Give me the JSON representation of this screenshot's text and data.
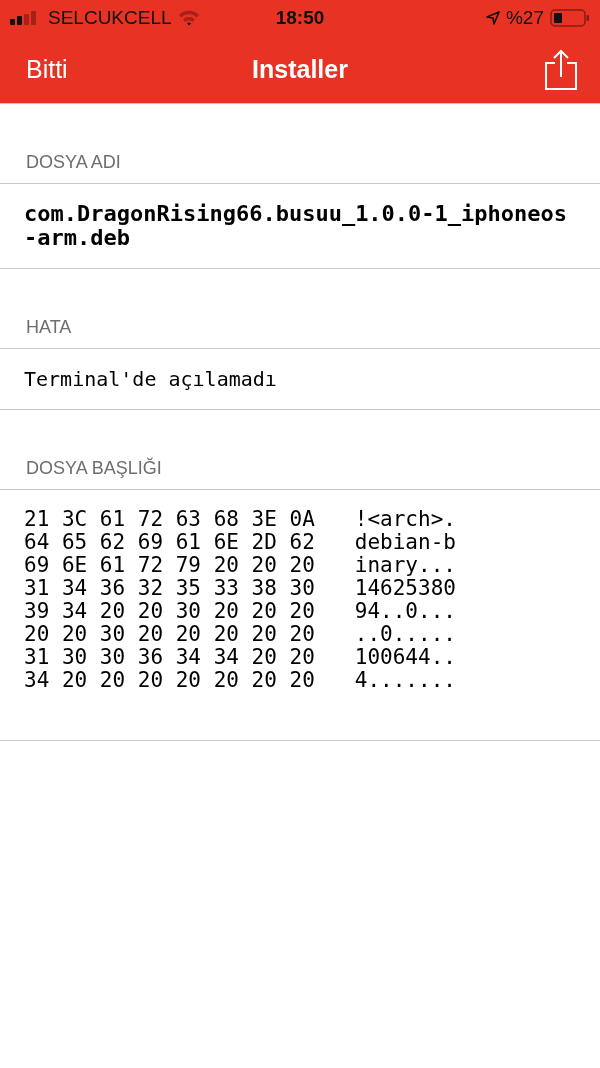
{
  "status_bar": {
    "carrier": "SELCUKCELL",
    "time": "18:50",
    "battery": "%27"
  },
  "nav_bar": {
    "back": "Bitti",
    "title": "Installer"
  },
  "sections": [
    {
      "kind": "text",
      "header": "DOSYA ADI",
      "value": "com.DragonRising66.busuu_1.0.0-1_iphoneos-arm.deb",
      "bold": true
    },
    {
      "kind": "text",
      "header": "HATA",
      "value": "Terminal'de açılamadı",
      "bold": false
    },
    {
      "kind": "hex",
      "header": "DOSYA BAŞLIĞI",
      "rows": [
        {
          "hex": "21 3C 61 72 63 68 3E 0A",
          "ascii": "!<arch>."
        },
        {
          "hex": "64 65 62 69 61 6E 2D 62",
          "ascii": "debian-b"
        },
        {
          "hex": "69 6E 61 72 79 20 20 20",
          "ascii": "inary..."
        },
        {
          "hex": "31 34 36 32 35 33 38 30",
          "ascii": "14625380"
        },
        {
          "hex": "39 34 20 20 30 20 20 20",
          "ascii": "94..0..."
        },
        {
          "hex": "20 20 30 20 20 20 20 20",
          "ascii": "..0....."
        },
        {
          "hex": "31 30 30 36 34 34 20 20",
          "ascii": "100644.."
        },
        {
          "hex": "34 20 20 20 20 20 20 20",
          "ascii": "4......."
        }
      ]
    }
  ]
}
